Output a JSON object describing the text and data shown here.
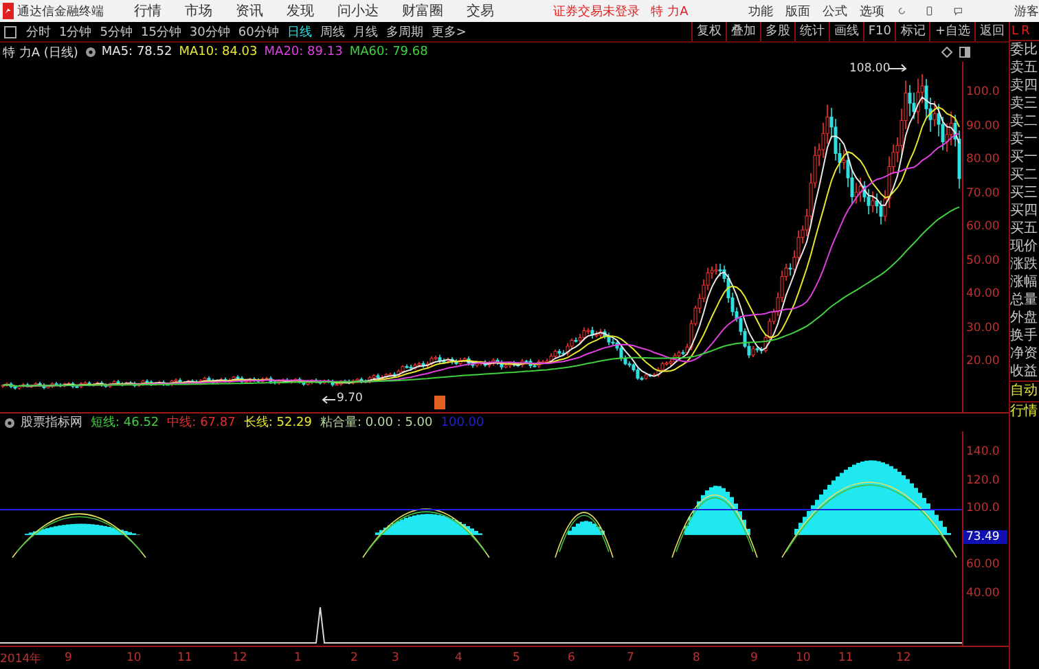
{
  "title_bar": {
    "app_name": "通达信金融终端",
    "menus": [
      "行情",
      "市场",
      "资讯",
      "发现",
      "问小达",
      "财富圈",
      "交易"
    ],
    "login_status": "证券交易未登录",
    "stock": "特 力A",
    "right_menus": [
      "功能",
      "版面",
      "公式",
      "选项"
    ],
    "user": "游客"
  },
  "period_tabs": [
    {
      "label": "分时",
      "selected": false
    },
    {
      "label": "1分钟",
      "selected": false
    },
    {
      "label": "5分钟",
      "selected": false
    },
    {
      "label": "15分钟",
      "selected": false
    },
    {
      "label": "30分钟",
      "selected": false
    },
    {
      "label": "60分钟",
      "selected": false
    },
    {
      "label": "日线",
      "selected": true
    },
    {
      "label": "周线",
      "selected": false
    },
    {
      "label": "月线",
      "selected": false
    },
    {
      "label": "多周期",
      "selected": false
    },
    {
      "label": "更多>",
      "selected": false
    }
  ],
  "tool_buttons": [
    "复权",
    "叠加",
    "多股",
    "统计",
    "画线",
    "F10",
    "标记",
    "+自选",
    "返回"
  ],
  "main_chart": {
    "title": "特 力A (日线)",
    "indicators": [
      {
        "label": "MA5: 78.52",
        "color": "#e8e8e8"
      },
      {
        "label": "MA10: 84.03",
        "color": "#e8e830"
      },
      {
        "label": "MA20: 89.13",
        "color": "#e040e0"
      },
      {
        "label": "MA60: 79.68",
        "color": "#40d040"
      }
    ],
    "high_label": "108.00",
    "low_label": "9.70",
    "price_ticks": [
      "100.0",
      "90.00",
      "80.00",
      "70.00",
      "60.00",
      "50.00",
      "40.00",
      "30.00",
      "20.00"
    ]
  },
  "indicator_panel": {
    "name": "股票指标网",
    "values": [
      {
        "label": "短线: 46.52",
        "color": "#40d040"
      },
      {
        "label": "中线: 67.87",
        "color": "#e03030"
      },
      {
        "label": "长线: 52.29",
        "color": "#e8e830"
      },
      {
        "label": "粘合量: 0.00 : 5.00",
        "color": "#b8d8a0"
      }
    ],
    "reference_value": "100.00",
    "current_label": "73.49",
    "ticks": [
      "140.0",
      "120.0",
      "100.0",
      "60.00",
      "40.00"
    ]
  },
  "date_axis": [
    "2014年",
    "9",
    "10",
    "11",
    "12",
    "1",
    "2",
    "3",
    "4",
    "5",
    "6",
    "7",
    "8",
    "9",
    "10",
    "11",
    "12"
  ],
  "side_panel": {
    "header": [
      "L",
      "R"
    ],
    "items": [
      "委比",
      "卖五",
      "卖四",
      "卖三",
      "卖二",
      "卖一",
      "买一",
      "买二",
      "买三",
      "买四",
      "买五",
      "现价",
      "涨跌",
      "涨幅",
      "总量",
      "外盘",
      "换手",
      "净资",
      "收益"
    ],
    "buttons": [
      "自动",
      "行情"
    ]
  }
}
